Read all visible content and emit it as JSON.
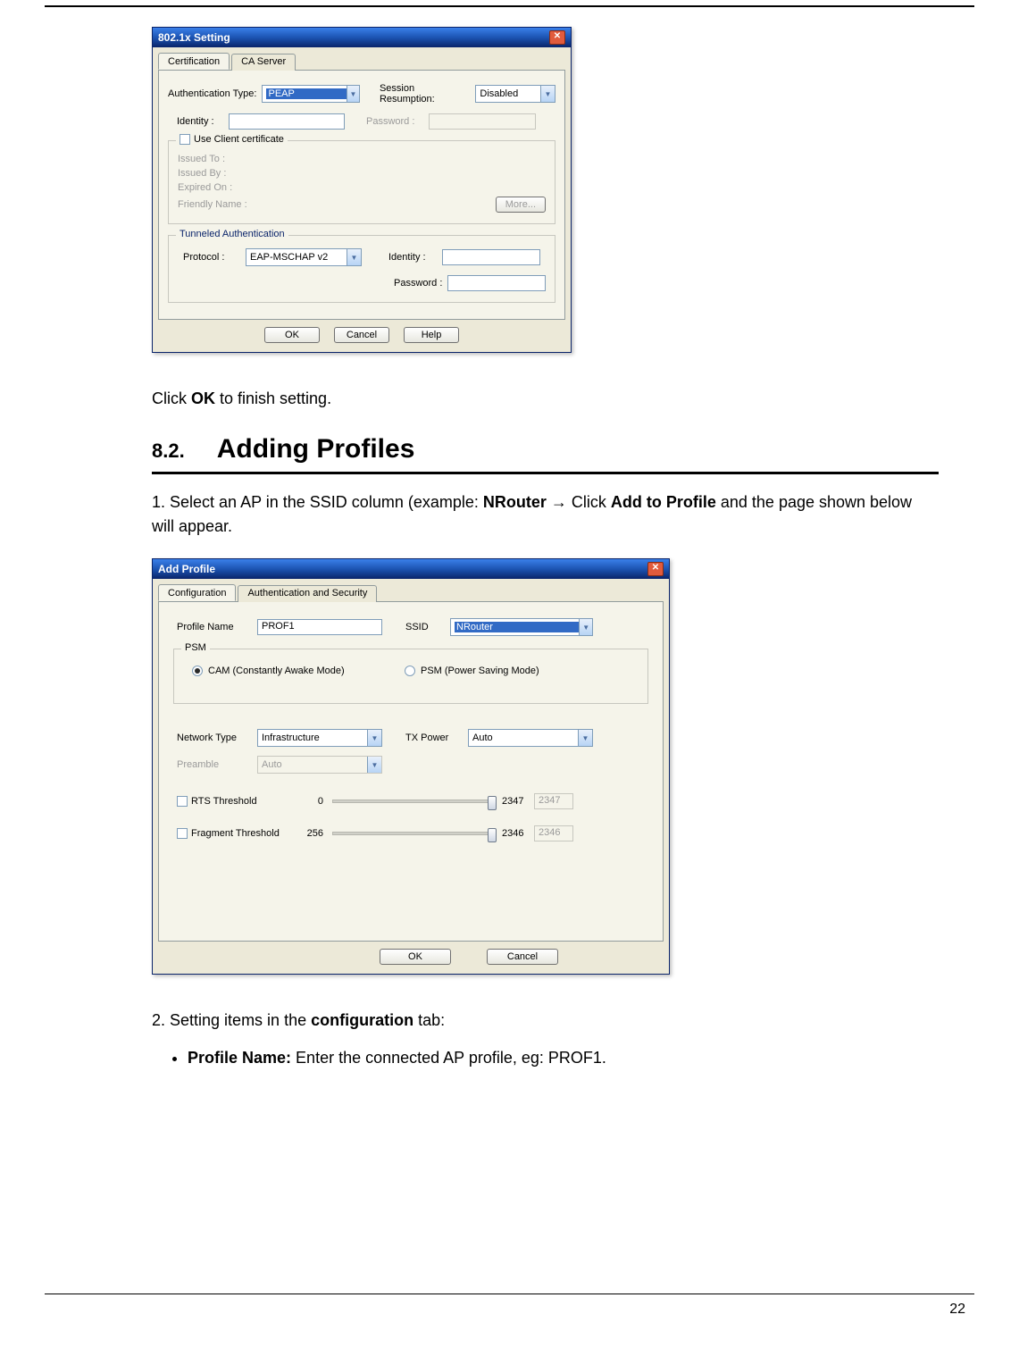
{
  "page_number": "22",
  "dialog1": {
    "title": "802.1x Setting",
    "tabs": [
      "Certification",
      "CA Server"
    ],
    "auth_type_label": "Authentication Type:",
    "auth_type_value": "PEAP",
    "session_label": "Session Resumption:",
    "session_value": "Disabled",
    "identity_label": "Identity :",
    "identity_value": "",
    "password_label": "Password :",
    "password_value": "",
    "use_client_cert_label": "Use Client certificate",
    "issued_to_label": "Issued To :",
    "issued_by_label": "Issued By :",
    "expired_on_label": "Expired On :",
    "friendly_name_label": "Friendly Name :",
    "more_btn": "More...",
    "tunneled_legend": "Tunneled Authentication",
    "protocol_label": "Protocol :",
    "protocol_value": "EAP-MSCHAP v2",
    "t_identity_label": "Identity :",
    "t_identity_value": "",
    "t_password_label": "Password :",
    "t_password_value": "",
    "ok_btn": "OK",
    "cancel_btn": "Cancel",
    "help_btn": "Help"
  },
  "text1_pre": "Click ",
  "text1_bold": "OK",
  "text1_post": " to finish setting.",
  "section_num": "8.2.",
  "section_title": "Adding Profiles",
  "step1_pre": "1. Select an AP in the SSID column (example: ",
  "step1_bold1": "NRouter",
  "step1_arrow": " → ",
  "step1_mid": "Click ",
  "step1_bold2": "Add to Profile",
  "step1_post": " and the page shown below will appear.",
  "dialog2": {
    "title": "Add Profile",
    "tabs": [
      "Configuration",
      "Authentication and Security"
    ],
    "profile_name_label": "Profile Name",
    "profile_name_value": "PROF1",
    "ssid_label": "SSID",
    "ssid_value": "NRouter",
    "psm_legend": "PSM",
    "cam_label": "CAM (Constantly Awake Mode)",
    "psm_label": "PSM (Power Saving Mode)",
    "network_type_label": "Network Type",
    "network_type_value": "Infrastructure",
    "tx_power_label": "TX Power",
    "tx_power_value": "Auto",
    "preamble_label": "Preamble",
    "preamble_value": "Auto",
    "rts_label": "RTS Threshold",
    "rts_min": "0",
    "rts_max": "2347",
    "rts_value": "2347",
    "frag_label": "Fragment Threshold",
    "frag_min": "256",
    "frag_max": "2346",
    "frag_value": "2346",
    "ok_btn": "OK",
    "cancel_btn": "Cancel"
  },
  "step2_pre": "2. Setting items in the ",
  "step2_bold": "configuration",
  "step2_post": " tab:",
  "bullet1_bold": "Profile Name:",
  "bullet1_rest": " Enter the connected AP profile, eg: PROF1."
}
